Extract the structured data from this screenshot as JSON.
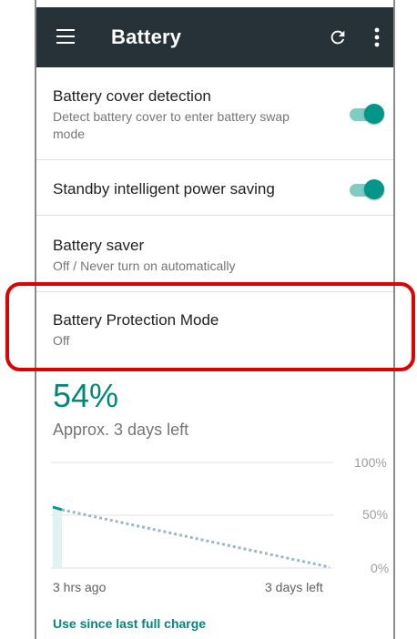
{
  "appbar": {
    "title": "Battery",
    "menu_icon": "menu-icon",
    "refresh_icon": "refresh-icon",
    "more_icon": "more-vert-icon"
  },
  "settings": [
    {
      "title": "Battery cover detection",
      "subtitle": "Detect battery cover to enter battery swap mode",
      "toggle": true
    },
    {
      "title": "Standby intelligent power saving",
      "subtitle": "",
      "toggle": true
    },
    {
      "title": "Battery saver",
      "subtitle": "Off / Never turn on automatically"
    },
    {
      "title": "Battery Protection Mode",
      "subtitle": "Off"
    }
  ],
  "battery": {
    "percent_text": "54%",
    "percent": 54,
    "approx": "Approx. 3 days left"
  },
  "graph": {
    "y_labels": [
      "100%",
      "50%",
      "0%"
    ],
    "x_start": "3 hrs ago",
    "x_end": "3 days left"
  },
  "footer": {
    "use_since": "Use since last full charge"
  },
  "colors": {
    "accent": "#009688",
    "appbar": "#263238",
    "highlight": "#e00000"
  }
}
